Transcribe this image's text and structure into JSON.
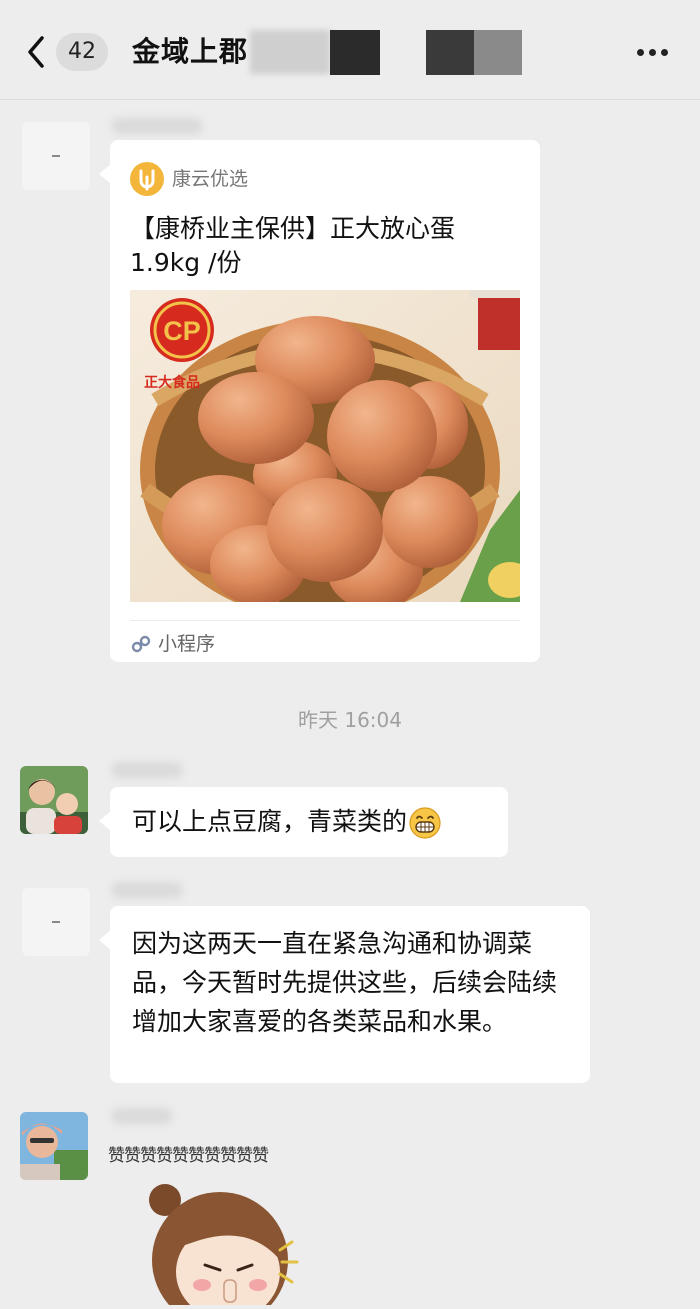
{
  "header": {
    "unread_count": "42",
    "title": "金域上郡"
  },
  "messages": {
    "card": {
      "source_name": "康云优选",
      "title": "【康桥业主保供】正大放心蛋 1.9kg /份",
      "image_brand": "CP",
      "image_brand_cn": "正大食品",
      "footer_label": "小程序"
    },
    "timestamp": "昨天 16:04",
    "msg1": {
      "text": "可以上点豆腐，青菜类的"
    },
    "msg2": {
      "text": "因为这两天一直在紧急沟通和协调菜品，今天暂时先提供这些，后续会陆续增加大家喜爱的各类菜品和水果。"
    },
    "msg3": {
      "text": "赞赞赞赞赞赞赞赞赞赞"
    }
  },
  "colors": {
    "chat_background": "#ededed",
    "bubble": "#ffffff",
    "brand_logo": "#f3b53a",
    "cp_red": "#d62a1e"
  },
  "icons": [
    "back-arrow-icon",
    "more-dots-icon",
    "mini-program-icon",
    "grinning-emoji-icon"
  ]
}
